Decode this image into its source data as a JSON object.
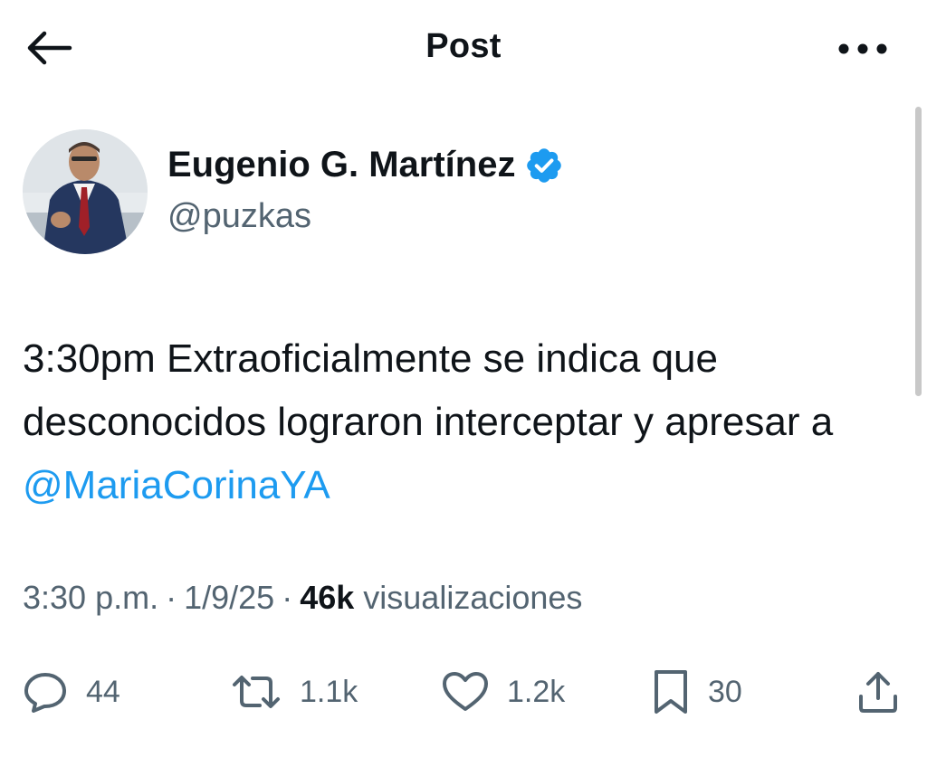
{
  "header": {
    "title": "Post",
    "back_icon": "arrow-left-icon",
    "more_icon": "more-horizontal-icon"
  },
  "author": {
    "name": "Eugenio G. Martínez",
    "handle": "@puzkas",
    "verified_icon": "verified-badge-icon",
    "verified_color": "#1d9bf0"
  },
  "tweet": {
    "text_prefix": "3:30pm Extraoficialmente se indica que desconocidos lograron interceptar y apresar a ",
    "mention": "@MariaCorinaYA",
    "mention_color": "#1d9bf0"
  },
  "meta": {
    "time": "3:30 p.m.",
    "separator": "·",
    "date": "1/9/25",
    "views_count": "46k",
    "views_label": "visualizaciones"
  },
  "actions": {
    "replies": "44",
    "reposts": "1.1k",
    "likes": "1.2k",
    "bookmarks": "30"
  },
  "colors": {
    "text_primary": "#0f1419",
    "text_secondary": "#536471",
    "accent": "#1d9bf0"
  }
}
